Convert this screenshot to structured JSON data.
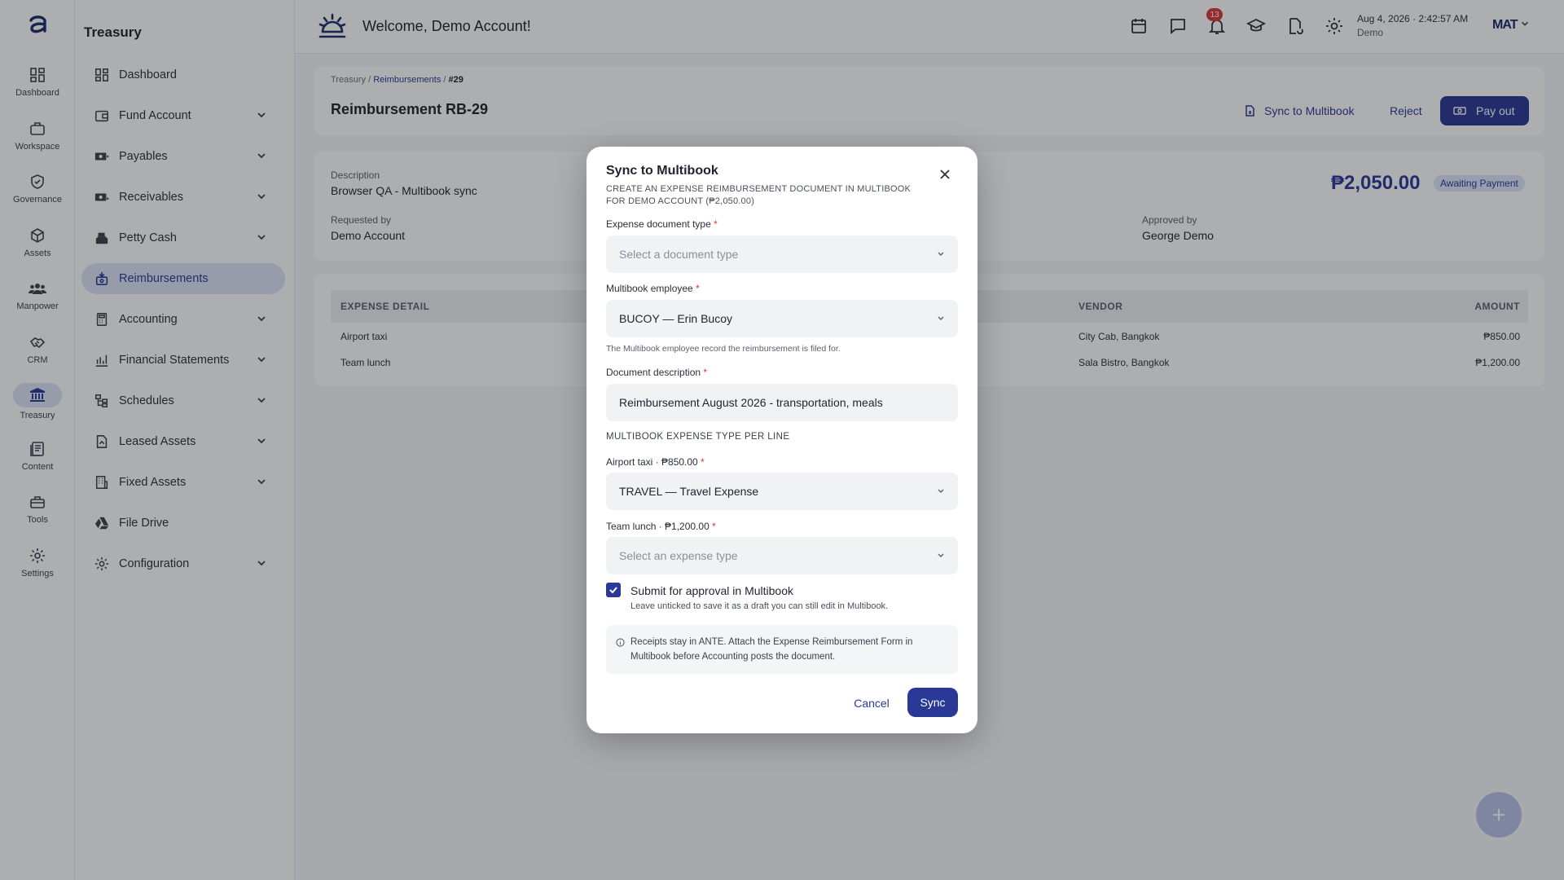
{
  "rail": {
    "items": [
      {
        "label": "Dashboard",
        "icon": "dashboard-grid-icon"
      },
      {
        "label": "Workspace",
        "icon": "briefcase-icon"
      },
      {
        "label": "Governance",
        "icon": "shield-check-icon"
      },
      {
        "label": "Assets",
        "icon": "cube-icon"
      },
      {
        "label": "Manpower",
        "icon": "people-icon"
      },
      {
        "label": "CRM",
        "icon": "handshake-icon"
      },
      {
        "label": "Treasury",
        "icon": "bank-icon"
      },
      {
        "label": "Content",
        "icon": "document-icon"
      },
      {
        "label": "Tools",
        "icon": "toolbox-icon"
      },
      {
        "label": "Settings",
        "icon": "gear-icon"
      }
    ],
    "active": "Treasury"
  },
  "sidebar": {
    "title": "Treasury",
    "items": [
      {
        "label": "Dashboard",
        "has_children": false
      },
      {
        "label": "Fund Account",
        "has_children": true
      },
      {
        "label": "Payables",
        "has_children": true
      },
      {
        "label": "Receivables",
        "has_children": true
      },
      {
        "label": "Petty Cash",
        "has_children": true
      },
      {
        "label": "Reimbursements",
        "has_children": false
      },
      {
        "label": "Accounting",
        "has_children": true
      },
      {
        "label": "Financial Statements",
        "has_children": true
      },
      {
        "label": "Schedules",
        "has_children": true
      },
      {
        "label": "Leased Assets",
        "has_children": true
      },
      {
        "label": "Fixed Assets",
        "has_children": true
      },
      {
        "label": "File Drive",
        "has_children": false
      },
      {
        "label": "Configuration",
        "has_children": true
      }
    ],
    "active": "Reimbursements"
  },
  "topbar": {
    "welcome": "Welcome, Demo Account!",
    "notification_count": "13",
    "date": "Aug 4, 2026",
    "time": "2:42:57 AM",
    "user_role": "Demo",
    "brand": "MAT"
  },
  "page": {
    "breadcrumb": {
      "root": "Treasury",
      "sep": "/",
      "section": "Reimbursements",
      "current": "#29"
    },
    "title": "Reimbursement RB-29",
    "actions": {
      "sync": "Sync to Multibook",
      "reject": "Reject",
      "payout": "Pay out"
    },
    "description_label": "Description",
    "description": "Browser QA - Multibook sync",
    "requested_by_label": "Requested by",
    "requested_by": "Demo Account",
    "approved_by_label": "Approved by",
    "approved_by": "George Demo",
    "amount": "₱2,050.00",
    "status": "Awaiting Payment"
  },
  "table": {
    "headers": {
      "detail": "EXPENSE DETAIL",
      "vendor": "VENDOR",
      "amount": "AMOUNT"
    },
    "rows": [
      {
        "detail": "Airport taxi",
        "vendor": "City Cab, Bangkok",
        "amount": "₱850.00"
      },
      {
        "detail": "Team lunch",
        "vendor": "Sala Bistro, Bangkok",
        "amount": "₱1,200.00"
      }
    ]
  },
  "modal": {
    "title": "Sync to Multibook",
    "subtitle": "Create an expense reimbursement document in Multibook for Demo Account (₱2,050.00)",
    "doc_type_label": "Expense document type",
    "doc_type_placeholder": "Select a document type",
    "employee_label": "Multibook employee",
    "employee_value": "BUCOY — Erin Bucoy",
    "employee_hint": "The Multibook employee record the reimbursement is filed for.",
    "desc_label": "Document description",
    "desc_value": "Reimbursement August 2026 - transportation, meals",
    "section": "MULTIBOOK EXPENSE TYPE PER LINE",
    "line1_label": "Airport taxi · ₱850.00",
    "line1_value": "TRAVEL — Travel Expense",
    "line2_label": "Team lunch · ₱1,200.00",
    "line2_placeholder": "Select an expense type",
    "required_mark": "*",
    "submit_label": "Submit for approval in Multibook",
    "submit_checked": true,
    "submit_hint": "Leave unticked to save it as a draft you can still edit in Multibook.",
    "info": "Receipts stay in ANTE. Attach the Expense Reimbursement Form in Multibook before Accounting posts the document.",
    "cancel": "Cancel",
    "sync": "Sync"
  },
  "colors": {
    "accent": "#2a3896",
    "status_bg": "#dde6fb",
    "badge": "#d93636"
  }
}
